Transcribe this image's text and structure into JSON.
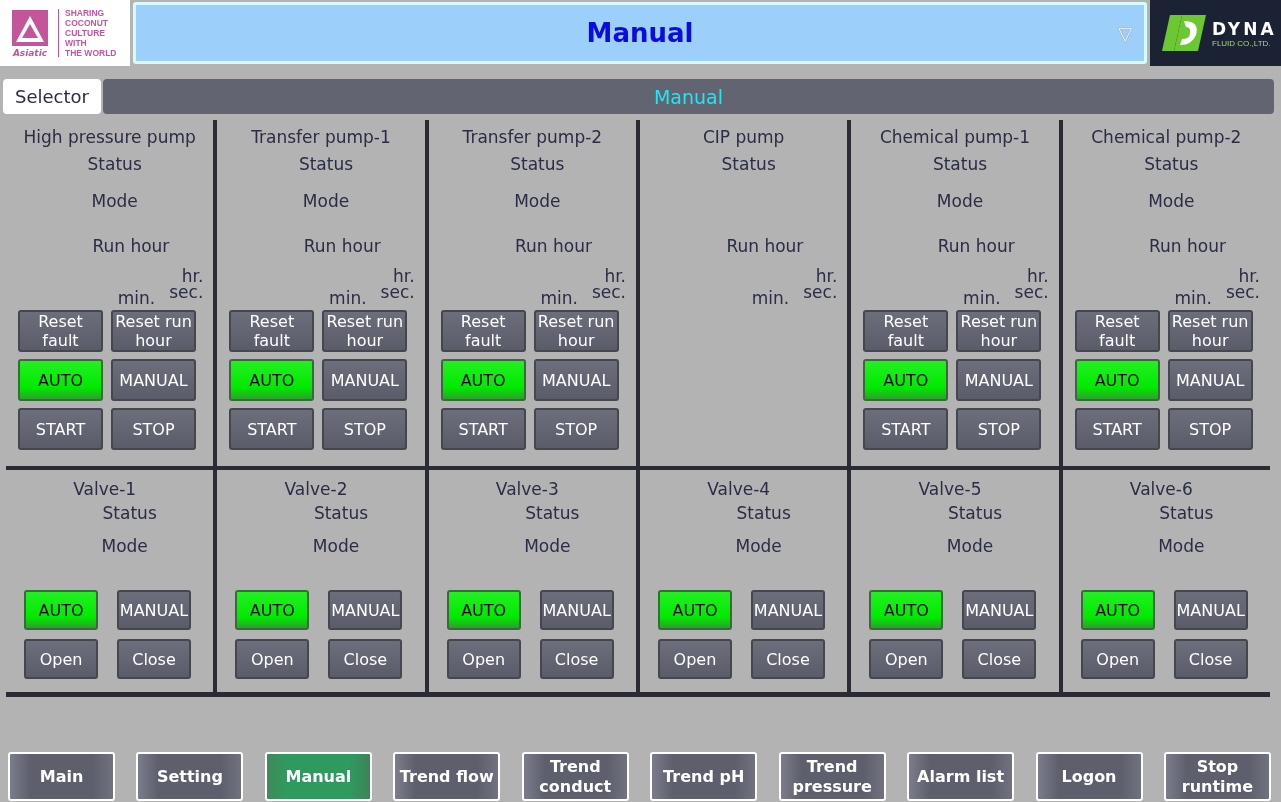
{
  "header": {
    "left_logo": {
      "brand": "Asiatic",
      "tagline": [
        "SHARING",
        "COCONUT",
        "CULTURE",
        "WITH",
        "THE WORLD"
      ]
    },
    "screen_selector": {
      "value": "Manual",
      "arrow": "▽"
    },
    "right_logo": {
      "brand": "DYNA",
      "subtitle": "FLUID CO.,LTD."
    }
  },
  "tabs": {
    "selector": "Selector",
    "current": "Manual"
  },
  "pumps": [
    {
      "name": "High pressure pump",
      "status_label": "Status",
      "mode_label": "Mode",
      "run_hour_label": "Run hour",
      "units": {
        "hr": "hr.",
        "min": "min.",
        "sec": "sec."
      },
      "buttons": [
        [
          {
            "label": "Reset fault",
            "on": false
          },
          {
            "label": "Reset run hour",
            "on": false
          }
        ],
        [
          {
            "label": "AUTO",
            "on": true
          },
          {
            "label": "MANUAL",
            "on": false
          }
        ],
        [
          {
            "label": "START",
            "on": false
          },
          {
            "label": "STOP",
            "on": false
          }
        ]
      ]
    },
    {
      "name": "Transfer pump-1",
      "status_label": "Status",
      "mode_label": "Mode",
      "run_hour_label": "Run hour",
      "units": {
        "hr": "hr.",
        "min": "min.",
        "sec": "sec."
      },
      "buttons": [
        [
          {
            "label": "Reset fault",
            "on": false
          },
          {
            "label": "Reset run hour",
            "on": false
          }
        ],
        [
          {
            "label": "AUTO",
            "on": true
          },
          {
            "label": "MANUAL",
            "on": false
          }
        ],
        [
          {
            "label": "START",
            "on": false
          },
          {
            "label": "STOP",
            "on": false
          }
        ]
      ]
    },
    {
      "name": "Transfer pump-2",
      "status_label": "Status",
      "mode_label": "Mode",
      "run_hour_label": "Run hour",
      "units": {
        "hr": "hr.",
        "min": "min.",
        "sec": "sec."
      },
      "buttons": [
        [
          {
            "label": "Reset fault",
            "on": false
          },
          {
            "label": "Reset run hour",
            "on": false
          }
        ],
        [
          {
            "label": "AUTO",
            "on": true
          },
          {
            "label": "MANUAL",
            "on": false
          }
        ],
        [
          {
            "label": "START",
            "on": false
          },
          {
            "label": "STOP",
            "on": false
          }
        ]
      ]
    },
    {
      "name": "CIP pump",
      "status_label": "Status",
      "run_hour_label": "Run hour",
      "units": {
        "hr": "hr.",
        "min": "min.",
        "sec": "sec."
      }
    },
    {
      "name": "Chemical pump-1",
      "status_label": "Status",
      "mode_label": "Mode",
      "run_hour_label": "Run hour",
      "units": {
        "hr": "hr.",
        "min": "min.",
        "sec": "sec."
      },
      "buttons": [
        [
          {
            "label": "Reset fault",
            "on": false
          },
          {
            "label": "Reset run hour",
            "on": false
          }
        ],
        [
          {
            "label": "AUTO",
            "on": true
          },
          {
            "label": "MANUAL",
            "on": false
          }
        ],
        [
          {
            "label": "START",
            "on": false
          },
          {
            "label": "STOP",
            "on": false
          }
        ]
      ]
    },
    {
      "name": "Chemical pump-2",
      "status_label": "Status",
      "mode_label": "Mode",
      "run_hour_label": "Run hour",
      "units": {
        "hr": "hr.",
        "min": "min.",
        "sec": "sec."
      },
      "buttons": [
        [
          {
            "label": "Reset fault",
            "on": false
          },
          {
            "label": "Reset run hour",
            "on": false
          }
        ],
        [
          {
            "label": "AUTO",
            "on": true
          },
          {
            "label": "MANUAL",
            "on": false
          }
        ],
        [
          {
            "label": "START",
            "on": false
          },
          {
            "label": "STOP",
            "on": false
          }
        ]
      ]
    }
  ],
  "valves": [
    {
      "name": "Valve-1",
      "status_label": "Status",
      "mode_label": "Mode",
      "buttons": [
        [
          {
            "label": "AUTO",
            "on": true
          },
          {
            "label": "MANUAL",
            "on": false
          }
        ],
        [
          {
            "label": "Open",
            "on": false
          },
          {
            "label": "Close",
            "on": false
          }
        ]
      ]
    },
    {
      "name": "Valve-2",
      "status_label": "Status",
      "mode_label": "Mode",
      "buttons": [
        [
          {
            "label": "AUTO",
            "on": true
          },
          {
            "label": "MANUAL",
            "on": false
          }
        ],
        [
          {
            "label": "Open",
            "on": false
          },
          {
            "label": "Close",
            "on": false
          }
        ]
      ]
    },
    {
      "name": "Valve-3",
      "status_label": "Status",
      "mode_label": "Mode",
      "buttons": [
        [
          {
            "label": "AUTO",
            "on": true
          },
          {
            "label": "MANUAL",
            "on": false
          }
        ],
        [
          {
            "label": "Open",
            "on": false
          },
          {
            "label": "Close",
            "on": false
          }
        ]
      ]
    },
    {
      "name": "Valve-4",
      "status_label": "Status",
      "mode_label": "Mode",
      "buttons": [
        [
          {
            "label": "AUTO",
            "on": true
          },
          {
            "label": "MANUAL",
            "on": false
          }
        ],
        [
          {
            "label": "Open",
            "on": false
          },
          {
            "label": "Close",
            "on": false
          }
        ]
      ]
    },
    {
      "name": "Valve-5",
      "status_label": "Status",
      "mode_label": "Mode",
      "buttons": [
        [
          {
            "label": "AUTO",
            "on": true
          },
          {
            "label": "MANUAL",
            "on": false
          }
        ],
        [
          {
            "label": "Open",
            "on": false
          },
          {
            "label": "Close",
            "on": false
          }
        ]
      ]
    },
    {
      "name": "Valve-6",
      "status_label": "Status",
      "mode_label": "Mode",
      "buttons": [
        [
          {
            "label": "AUTO",
            "on": true
          },
          {
            "label": "MANUAL",
            "on": false
          }
        ],
        [
          {
            "label": "Open",
            "on": false
          },
          {
            "label": "Close",
            "on": false
          }
        ]
      ]
    }
  ],
  "nav": [
    {
      "label": "Main",
      "selected": false
    },
    {
      "label": "Setting",
      "selected": false
    },
    {
      "label": "Manual",
      "selected": true
    },
    {
      "label": "Trend flow",
      "selected": false
    },
    {
      "label": "Trend conduct",
      "selected": false
    },
    {
      "label": "Trend pH",
      "selected": false
    },
    {
      "label": "Trend pressure",
      "selected": false
    },
    {
      "label": "Alarm list",
      "selected": false
    },
    {
      "label": "Logon",
      "selected": false
    },
    {
      "label": "Stop runtime",
      "selected": false
    }
  ]
}
